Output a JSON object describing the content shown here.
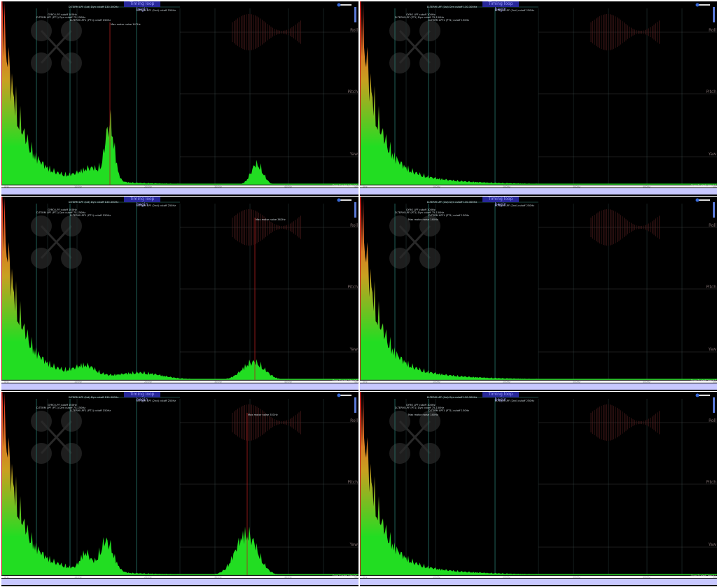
{
  "app": {
    "tag_label": "Timing loop begin",
    "bottom_right_label": "Gyro Scaled [deg/s]",
    "side_labels": [
      "Roll",
      "Pitch",
      "Yaw"
    ]
  },
  "filter_labels": [
    "D-TERM LPF (1st) Dyn cutoff 130-300Hz",
    "D-TERM LPF (2nd) cutoff 250Hz",
    "GYRO LPF cutoff 100Hz",
    "D-TERM LPF (PT1) Dyn cutoff 75-150Hz",
    "D-TERM LPF1 (PT1) cutoff 150Hz"
  ],
  "panels": [
    {
      "id": "top-left",
      "noise_label": "Max motor noise 147Hz",
      "axis": [
        "0Hz",
        "100Hz",
        "200Hz",
        "300Hz",
        "400Hz",
        "500Hz"
      ]
    },
    {
      "id": "top-right",
      "noise_label": "",
      "axis": [
        "0Hz",
        "100Hz",
        "200Hz",
        "300Hz",
        "400Hz",
        "500Hz"
      ]
    },
    {
      "id": "middle-left",
      "noise_label": "Max motor noise 362Hz",
      "axis": [
        "0Hz",
        "100Hz",
        "200Hz",
        "300Hz",
        "400Hz",
        "500Hz"
      ]
    },
    {
      "id": "middle-right",
      "noise_label": "Max motor noise 140Hz",
      "axis": [
        "0Hz",
        "100Hz",
        "200Hz",
        "300Hz",
        "400Hz",
        "500Hz"
      ]
    },
    {
      "id": "bottom-left",
      "noise_label": "Max motor noise 351Hz",
      "axis": [
        "0Hz",
        "100Hz",
        "200Hz",
        "300Hz",
        "400Hz",
        "500Hz"
      ]
    },
    {
      "id": "bottom-right",
      "noise_label": "Max motor noise 140Hz",
      "axis": [
        "0Hz",
        "100Hz",
        "200Hz",
        "300Hz",
        "400Hz",
        "500Hz"
      ]
    }
  ],
  "colors": {
    "spectrum_top": "#ff2a2a",
    "spectrum_mid": "#c8a020",
    "spectrum_low": "#22dd22",
    "background": "#000000",
    "timeline": "#c8c8ff"
  }
}
